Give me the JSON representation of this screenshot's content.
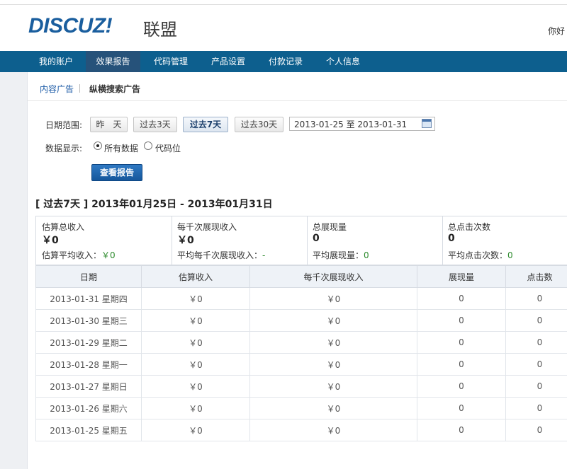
{
  "brand": {
    "logo": "DISCUZ!",
    "sub": "联盟",
    "greeting": "你好"
  },
  "nav": [
    "我的账户",
    "效果报告",
    "代码管理",
    "产品设置",
    "付款记录",
    "个人信息"
  ],
  "subtabs": {
    "tab1": "内容广告",
    "tab2": "纵横搜索广告"
  },
  "filter": {
    "date_label": "日期范围:",
    "buttons": [
      "昨　天",
      "过去3天",
      "过去7天",
      "过去30天"
    ],
    "date_from": "2013-01-25",
    "date_to_word": "至",
    "date_to": "2013-01-31",
    "display_label": "数据显示:",
    "radio_all": "所有数据",
    "radio_code": "代码位",
    "submit": "查看报告"
  },
  "period_title": "[ 过去7天 ] 2013年01月25日 - 2013年01月31日",
  "summary": [
    {
      "title": "估算总收入",
      "value": "￥0",
      "sub_label": "估算平均收入：",
      "sub_value": "￥0"
    },
    {
      "title": "每千次展现收入",
      "value": "￥0",
      "sub_label": "平均每千次展现收入：",
      "sub_value": "-"
    },
    {
      "title": "总展现量",
      "value": "0",
      "sub_label": "平均展现量：",
      "sub_value": "0"
    },
    {
      "title": "总点击次数",
      "value": "0",
      "sub_label": "平均点击次数：",
      "sub_value": "0"
    }
  ],
  "table": {
    "headers": [
      "日期",
      "估算收入",
      "每千次展现收入",
      "展现量",
      "点击数"
    ],
    "rows": [
      [
        "2013-01-31 星期四",
        "￥0",
        "￥0",
        "0",
        "0"
      ],
      [
        "2013-01-30 星期三",
        "￥0",
        "￥0",
        "0",
        "0"
      ],
      [
        "2013-01-29 星期二",
        "￥0",
        "￥0",
        "0",
        "0"
      ],
      [
        "2013-01-28 星期一",
        "￥0",
        "￥0",
        "0",
        "0"
      ],
      [
        "2013-01-27 星期日",
        "￥0",
        "￥0",
        "0",
        "0"
      ],
      [
        "2013-01-26 星期六",
        "￥0",
        "￥0",
        "0",
        "0"
      ],
      [
        "2013-01-25 星期五",
        "￥0",
        "￥0",
        "0",
        "0"
      ]
    ]
  },
  "colors": {
    "nav": "#0d5f8e",
    "nav_active": "#26527a",
    "link": "#1b5aa6",
    "primary": "#1a62a8",
    "green": "#2e8b2e"
  }
}
